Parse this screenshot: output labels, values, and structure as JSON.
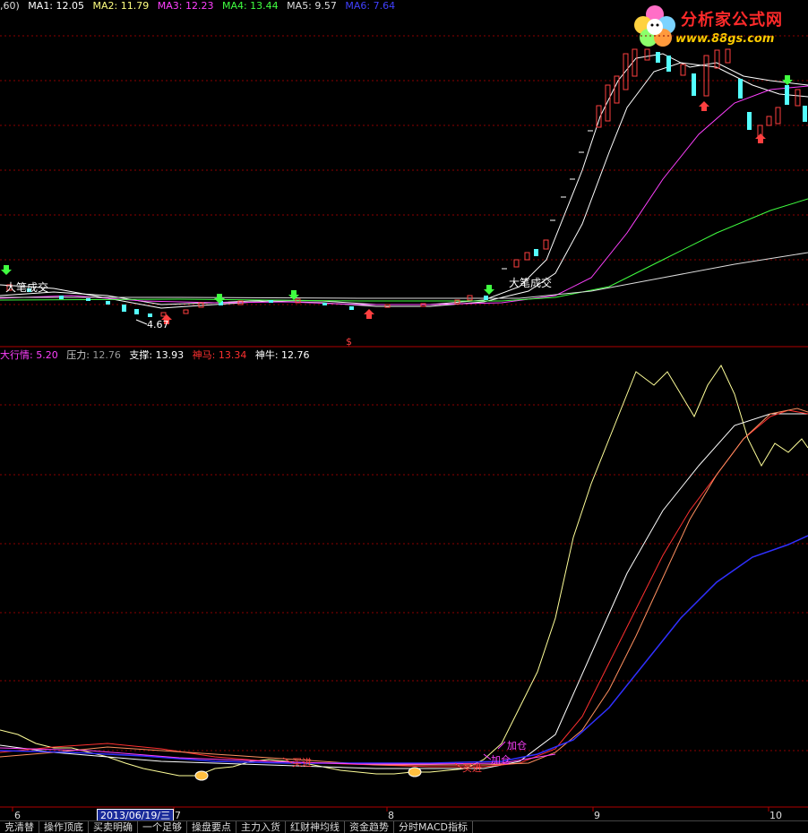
{
  "top_indicators": {
    "prefix": ",60)",
    "ma1": "MA1: 12.05",
    "ma2": "MA2: 11.79",
    "ma3": "MA3: 12.23",
    "ma4": "MA4: 13.44",
    "ma5": "MA5: 9.57",
    "ma6": "MA6: 7.64"
  },
  "mid_indicators": {
    "market": "大行情: 5.20",
    "pressure_label": "压力:",
    "pressure": "12.76",
    "support": "支撑: 13.93",
    "shenma": "神马: 13.34",
    "shenniu": "神牛: 12.76"
  },
  "annotations": {
    "big_trade_1": "大笔成交",
    "big_trade_2": "大笔成交",
    "low_price": "4.67",
    "dollar": "$",
    "add_pos_1": "加仓",
    "add_pos_2": "加仓",
    "buy_1": "买进",
    "buy_2": "买进"
  },
  "logo": {
    "name": "分析家公式网",
    "url": "www.88gs.com"
  },
  "x_axis": {
    "labels": [
      "6",
      "7",
      "8",
      "9",
      "10"
    ],
    "selected_date": "2013/06/19/三"
  },
  "tabs": [
    "克清替",
    "操作顶底",
    "买卖明确",
    "一个足够",
    "操盘要点",
    "主力入货",
    "红财神均线",
    "资金趋势",
    "分时MACD指标"
  ],
  "colors": {
    "up": "#ff4040",
    "down": "#54ffff",
    "ma_white": "#ffffff",
    "ma_yellow": "#ffff80",
    "ma_magenta": "#ff40ff",
    "ma_green": "#40ff40",
    "ma_blue": "#4040ff",
    "grid": "#8b0000"
  }
}
